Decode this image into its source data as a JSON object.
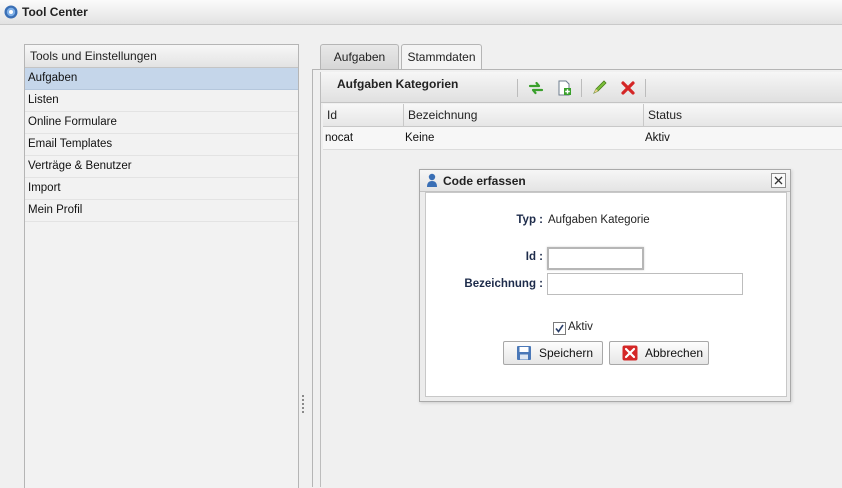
{
  "window": {
    "title": "Tool Center"
  },
  "sidebar": {
    "header": "Tools und Einstellungen",
    "items": [
      {
        "label": "Aufgaben",
        "selected": true
      },
      {
        "label": "Listen"
      },
      {
        "label": "Online Formulare"
      },
      {
        "label": "Email Templates"
      },
      {
        "label": "Verträge & Benutzer"
      },
      {
        "label": "Import"
      },
      {
        "label": "Mein Profil"
      }
    ]
  },
  "tabs": [
    {
      "label": "Aufgaben"
    },
    {
      "label": "Stammdaten",
      "active": true
    }
  ],
  "panel": {
    "title": "Aufgaben Kategorien",
    "toolbar_icons": [
      "refresh-icon",
      "new-document-icon",
      "edit-pencil-icon",
      "delete-x-icon"
    ]
  },
  "grid": {
    "columns": [
      "Id",
      "Bezeichnung",
      "Status"
    ],
    "rows": [
      {
        "id": "nocat",
        "bezeichnung": "Keine",
        "status": "Aktiv"
      }
    ]
  },
  "dialog": {
    "title": "Code erfassen",
    "typ_label": "Typ :",
    "typ_value": "Aufgaben Kategorie",
    "id_label": "Id :",
    "id_value": "",
    "bezeichnung_label": "Bezeichnung :",
    "bezeichnung_value": "",
    "aktiv_label": "Aktiv",
    "aktiv_checked": true,
    "save_label": "Speichern",
    "cancel_label": "Abbrechen"
  },
  "colors": {
    "selection": "#c5d6ea",
    "label_text": "#1d2b4a",
    "delete_red": "#d42626",
    "refresh_green": "#3aa02c"
  }
}
